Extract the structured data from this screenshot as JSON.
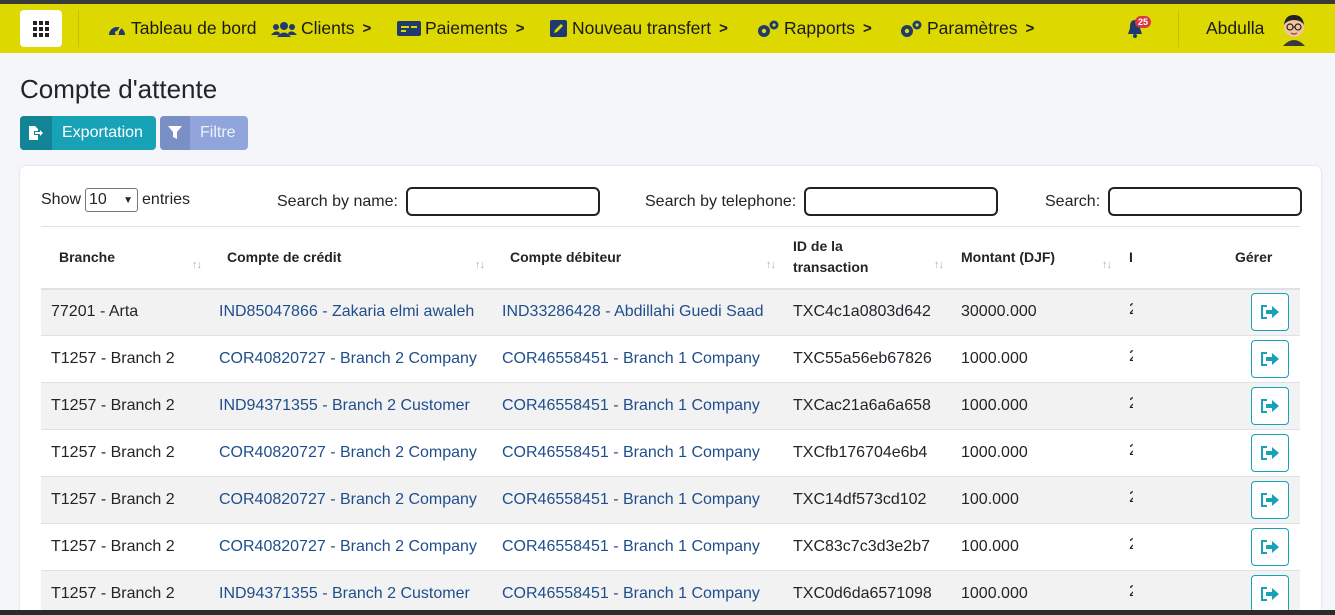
{
  "navbar": {
    "items": [
      {
        "label": "Tableau de bord",
        "icon": "dashboard-icon",
        "has_chevron": false
      },
      {
        "label": "Clients",
        "icon": "users-icon",
        "has_chevron": true
      },
      {
        "label": "Paiements",
        "icon": "money-icon",
        "has_chevron": true
      },
      {
        "label": "Nouveau transfert",
        "icon": "edit-icon",
        "has_chevron": true
      },
      {
        "label": "Rapports",
        "icon": "cogs-icon",
        "has_chevron": true
      },
      {
        "label": "Paramètres",
        "icon": "cogs-icon",
        "has_chevron": true
      }
    ],
    "notification_count": "25",
    "username": "Abdulla",
    "chevron": ">"
  },
  "page": {
    "title": "Compte d'attente",
    "export_label": "Exportation",
    "filter_label": "Filtre"
  },
  "controls": {
    "show_label": "Show",
    "entries_value": "10",
    "entries_label": "entries",
    "search_name_label": "Search by name:",
    "search_name_value": "",
    "search_phone_label": "Search by telephone:",
    "search_phone_value": "",
    "search_label": "Search:",
    "search_value": ""
  },
  "table": {
    "columns": [
      "Branche",
      "Compte de crédit",
      "Compte débiteur",
      "ID de la transaction",
      "Montant (DJF)",
      "I",
      "Gérer"
    ],
    "rows": [
      {
        "branche": "77201 - Arta",
        "credit": "IND85047866 - Zakaria elmi awaleh",
        "debit": "IND33286428 - Abdillahi Guedi Saad",
        "txid": "TXC4c1a0803d642",
        "montant": "30000.000",
        "extra": "2"
      },
      {
        "branche": "T1257 - Branch 2",
        "credit": "COR40820727 - Branch 2 Company",
        "debit": "COR46558451 - Branch 1 Company",
        "txid": "TXC55a56eb67826",
        "montant": "1000.000",
        "extra": "2"
      },
      {
        "branche": "T1257 - Branch 2",
        "credit": "IND94371355 - Branch 2 Customer",
        "debit": "COR46558451 - Branch 1 Company",
        "txid": "TXCac21a6a6a658",
        "montant": "1000.000",
        "extra": "2"
      },
      {
        "branche": "T1257 - Branch 2",
        "credit": "COR40820727 - Branch 2 Company",
        "debit": "COR46558451 - Branch 1 Company",
        "txid": "TXCfb176704e6b4",
        "montant": "1000.000",
        "extra": "2"
      },
      {
        "branche": "T1257 - Branch 2",
        "credit": "COR40820727 - Branch 2 Company",
        "debit": "COR46558451 - Branch 1 Company",
        "txid": "TXC14df573cd102",
        "montant": "100.000",
        "extra": "2"
      },
      {
        "branche": "T1257 - Branch 2",
        "credit": "COR40820727 - Branch 2 Company",
        "debit": "COR46558451 - Branch 1 Company",
        "txid": "TXC83c7c3d3e2b7",
        "montant": "100.000",
        "extra": "2"
      },
      {
        "branche": "T1257 - Branch 2",
        "credit": "IND94371355 - Branch 2 Customer",
        "debit": "COR46558451 - Branch 1 Company",
        "txid": "TXC0d6da6571098",
        "montant": "1000.000",
        "extra": "2"
      }
    ]
  },
  "colors": {
    "navbar_bg": "#dcd800",
    "export_btn": "#17a2b8",
    "filter_btn": "#8fa5dc",
    "link": "#1f4e8c",
    "badge": "#dc3545"
  }
}
